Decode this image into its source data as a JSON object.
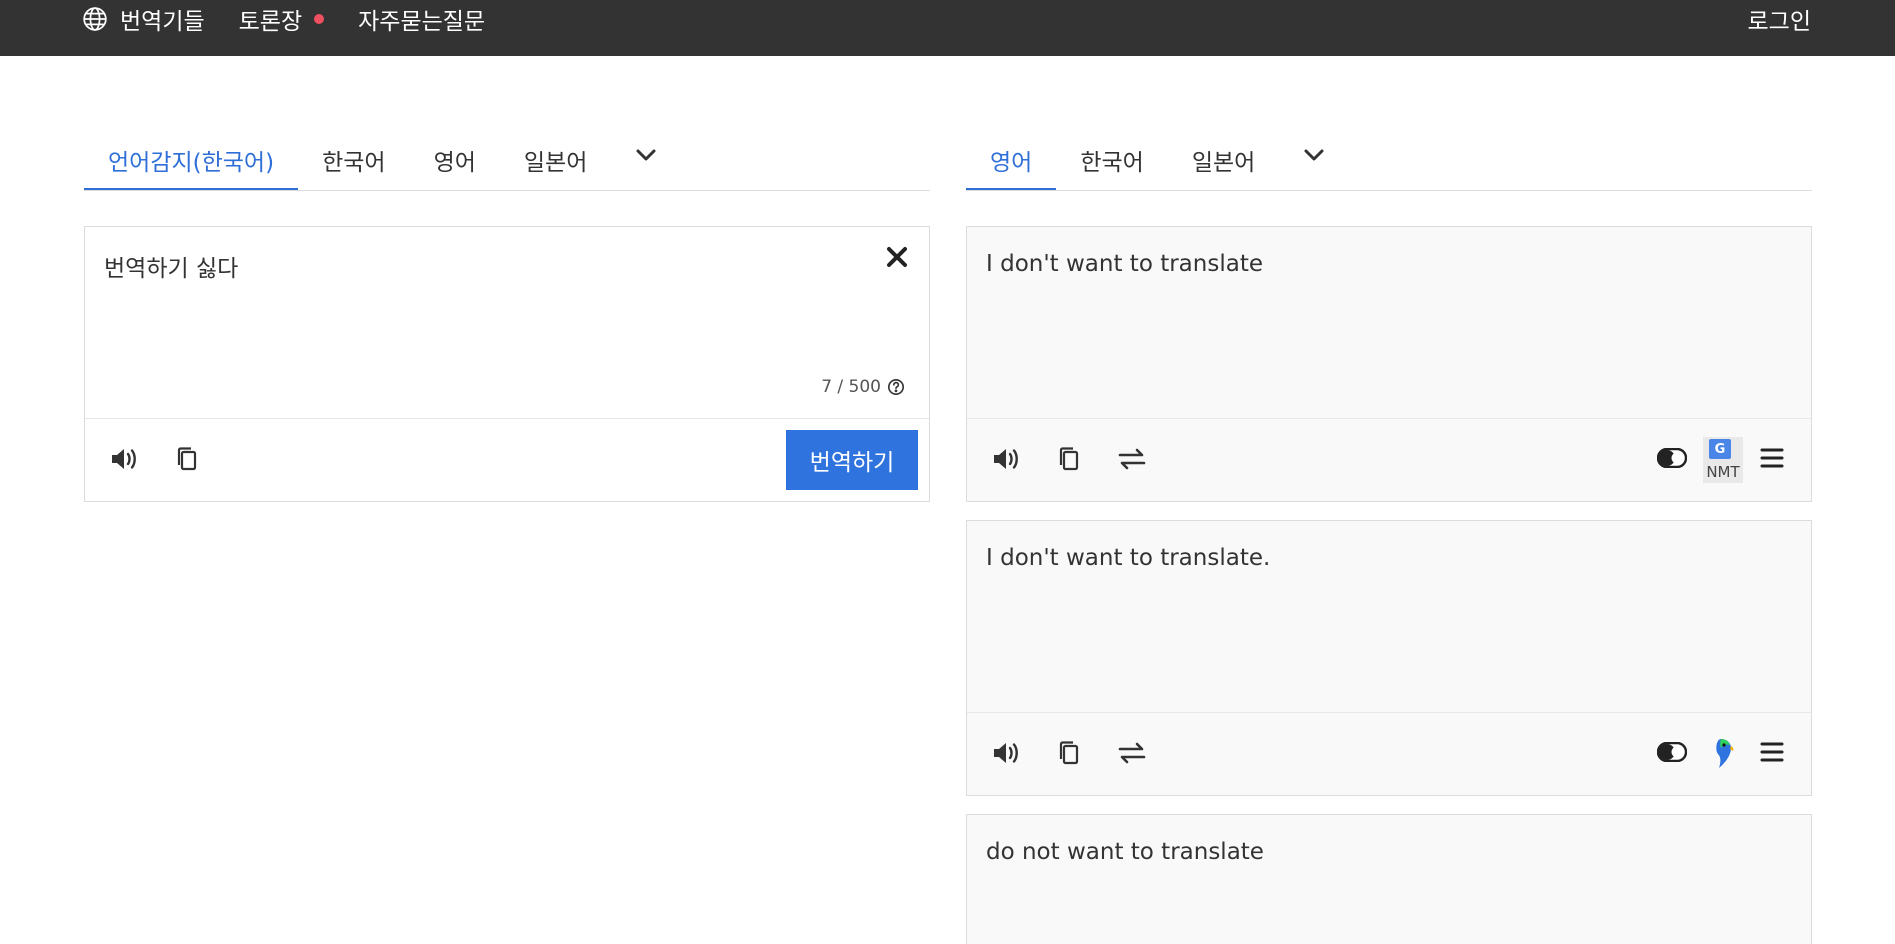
{
  "nav": {
    "translators": "번역기들",
    "forum": "토론장",
    "faq": "자주묻는질문",
    "login": "로그인",
    "icons": {
      "translators": "globe-icon"
    },
    "forum_dot_color": "#ef5060"
  },
  "source": {
    "tabs": [
      "언어감지(한국어)",
      "한국어",
      "영어",
      "일본어"
    ],
    "active_tab": 0,
    "text": "번역하기 싫다",
    "counter": "7 / 500",
    "translate_button": "번역하기",
    "icons": [
      "speaker-icon",
      "copy-icon",
      "close-icon",
      "help-circle-icon",
      "chevron-down-icon"
    ]
  },
  "target": {
    "tabs": [
      "영어",
      "한국어",
      "일본어"
    ],
    "active_tab": 0
  },
  "results": [
    {
      "text": "I don't want to translate",
      "engine_badge": "NMT",
      "engine_icon": "google-translate-icon"
    },
    {
      "text": "I don't want to translate.",
      "engine_icon": "papago-parrot-icon"
    },
    {
      "text": "do not want to translate"
    }
  ],
  "colors": {
    "topbar": "#333333",
    "accent": "#2f6fd8",
    "button": "#2f74de"
  }
}
